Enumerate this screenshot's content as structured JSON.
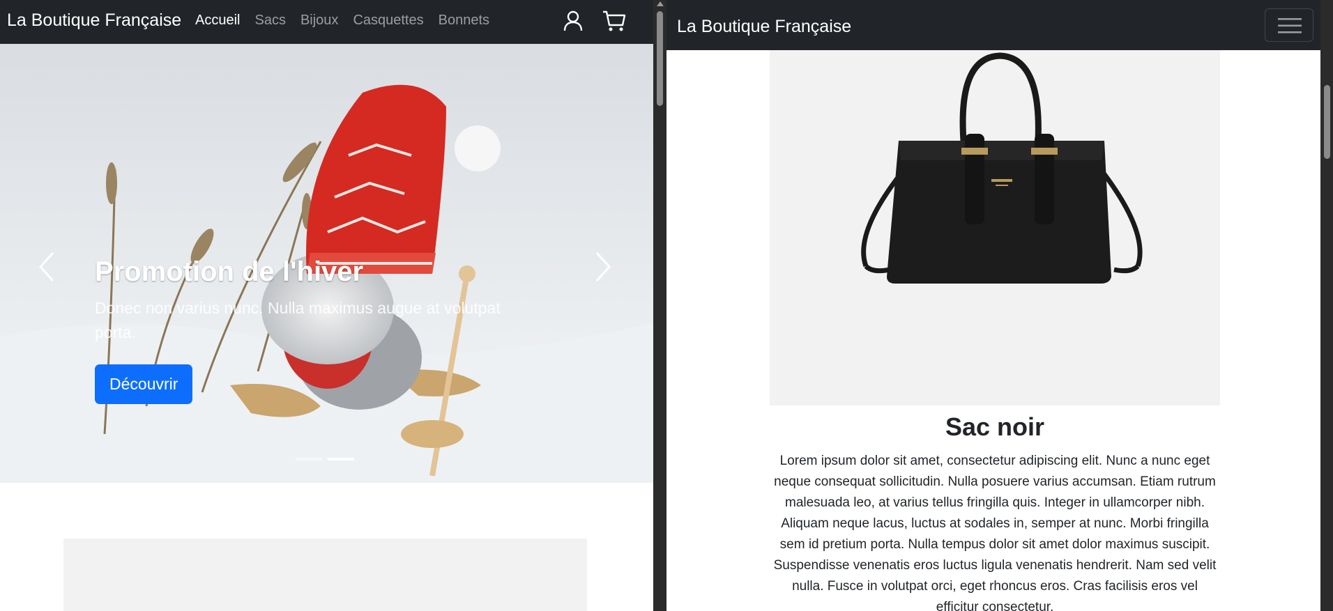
{
  "left": {
    "navbar": {
      "brand": "La Boutique Française",
      "links": [
        {
          "label": "Accueil",
          "active": true
        },
        {
          "label": "Sacs",
          "active": false
        },
        {
          "label": "Bijoux",
          "active": false
        },
        {
          "label": "Casquettes",
          "active": false
        },
        {
          "label": "Bonnets",
          "active": false
        }
      ],
      "icons": [
        "user-icon",
        "cart-icon"
      ]
    },
    "carousel": {
      "title": "Promotion de l'hiver",
      "text": "Donec non varius nunc. Nulla maximus augue at volutpat porta.",
      "button_label": "Découvrir",
      "slide_count": 2,
      "active_slide": 2
    }
  },
  "right": {
    "navbar": {
      "brand": "La Boutique Française",
      "toggler_icon": "hamburger-icon"
    },
    "product": {
      "title": "Sac noir",
      "description": "Lorem ipsum dolor sit amet, consectetur adipiscing elit. Nunc a nunc eget neque consequat sollicitudin. Nulla posuere varius accumsan. Etiam rutrum malesuada leo, at varius tellus fringilla quis. Integer in ullamcorper nibh. Aliquam neque lacus, luctus at sodales in, semper at nunc. Morbi fringilla sem id pretium porta. Nulla tempus dolor sit amet dolor maximus suscipit. Suspendisse venenatis eros luctus ligula venenatis hendrerit. Nam sed velit nulla. Fusce in volutpat orci, eget rhoncus eros. Cras facilisis eros vel efficitur consectetur."
    }
  },
  "colors": {
    "navbar_bg": "#212529",
    "primary": "#0d6efd",
    "card_bg": "#f2f2f2",
    "hat_red": "#d42a22"
  }
}
